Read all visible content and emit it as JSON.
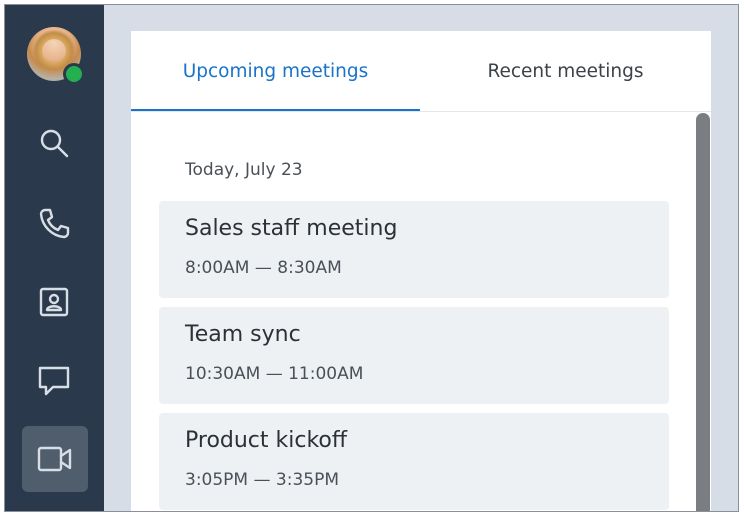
{
  "sidebar": {
    "avatar": {
      "status": "online",
      "status_color": "#25b04f"
    },
    "items": [
      {
        "icon": "search-icon",
        "active": false
      },
      {
        "icon": "phone-icon",
        "active": false
      },
      {
        "icon": "contact-card-icon",
        "active": false
      },
      {
        "icon": "chat-bubble-icon",
        "active": false
      },
      {
        "icon": "video-camera-icon",
        "active": true
      }
    ]
  },
  "tabs": {
    "upcoming": "Upcoming meetings",
    "recent": "Recent meetings",
    "active": "upcoming"
  },
  "meetings": {
    "date_heading": "Today, July 23",
    "items": [
      {
        "title": "Sales staff meeting",
        "time": "8:00AM — 8:30AM"
      },
      {
        "title": "Team sync",
        "time": "10:30AM — 11:00AM"
      },
      {
        "title": "Product kickoff",
        "time": "3:05PM — 3:35PM"
      }
    ]
  },
  "colors": {
    "sidebar": "#2a3a4c",
    "accent": "#1a73c9",
    "card_bg": "#eef1f4"
  }
}
